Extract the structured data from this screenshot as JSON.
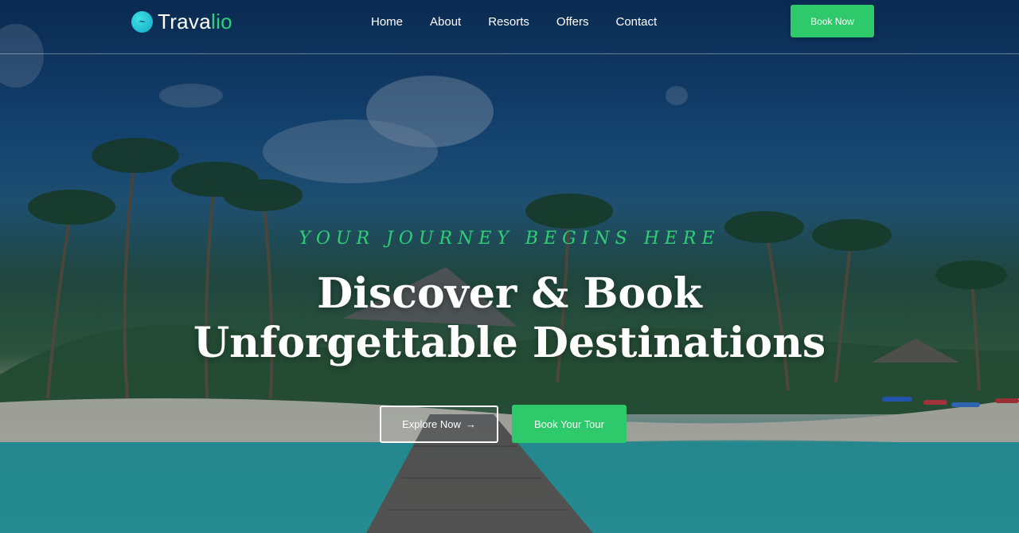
{
  "brand": {
    "name_start": "Trava",
    "name_end": "lio",
    "logo_icon": "wave-icon"
  },
  "nav": {
    "items": [
      "Home",
      "About",
      "Resorts",
      "Offers",
      "Contact"
    ],
    "cta_label": "Book Now"
  },
  "hero": {
    "tagline": "YOUR JOURNEY BEGINS HERE",
    "headline_line1": "Discover & Book",
    "headline_line2": "Unforgettable Destinations",
    "primary_button": "Explore Now",
    "primary_button_icon": "arrow-right-icon",
    "secondary_button": "Book Your Tour"
  },
  "colors": {
    "accent": "#2ec96b",
    "logo": "#14b8cf",
    "text": "#ffffff"
  }
}
